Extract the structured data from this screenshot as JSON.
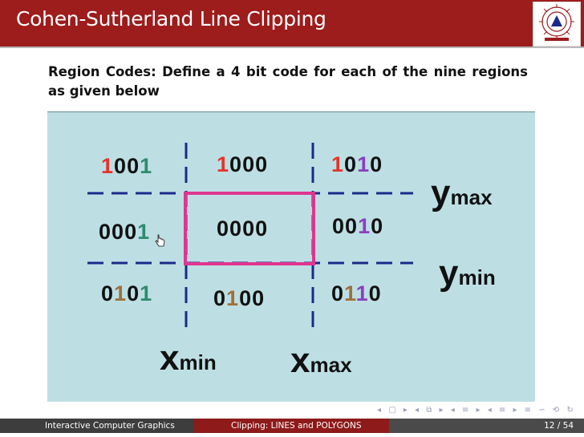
{
  "slide": {
    "title": "Cohen-Sutherland Line Clipping",
    "body": "Region Codes: Define a 4 bit code for each of the nine regions as given below"
  },
  "figure": {
    "codes": [
      {
        "name": "top-left",
        "digits": [
          "1",
          "0",
          "0",
          "1"
        ],
        "colors": [
          "#e8332a",
          "#111111",
          "#111111",
          "#2e8b6e"
        ]
      },
      {
        "name": "top",
        "digits": [
          "1",
          "0",
          "0",
          "0"
        ],
        "colors": [
          "#e8332a",
          "#111111",
          "#111111",
          "#111111"
        ]
      },
      {
        "name": "top-right",
        "digits": [
          "1",
          "0",
          "1",
          "0"
        ],
        "colors": [
          "#e8332a",
          "#111111",
          "#8a3fbf",
          "#111111"
        ]
      },
      {
        "name": "left",
        "digits": [
          "0",
          "0",
          "0",
          "1"
        ],
        "colors": [
          "#111111",
          "#111111",
          "#111111",
          "#2e8b6e"
        ]
      },
      {
        "name": "center",
        "digits": [
          "0",
          "0",
          "0",
          "0"
        ],
        "colors": [
          "#111111",
          "#111111",
          "#111111",
          "#111111"
        ]
      },
      {
        "name": "right",
        "digits": [
          "0",
          "0",
          "1",
          "0"
        ],
        "colors": [
          "#111111",
          "#111111",
          "#8a3fbf",
          "#111111"
        ]
      },
      {
        "name": "bottom-left",
        "digits": [
          "0",
          "1",
          "0",
          "1"
        ],
        "colors": [
          "#111111",
          "#a0703a",
          "#111111",
          "#2e8b6e"
        ]
      },
      {
        "name": "bottom",
        "digits": [
          "0",
          "1",
          "0",
          "0"
        ],
        "colors": [
          "#111111",
          "#a0703a",
          "#111111",
          "#111111"
        ]
      },
      {
        "name": "bottom-right",
        "digits": [
          "0",
          "1",
          "1",
          "0"
        ],
        "colors": [
          "#111111",
          "#a0703a",
          "#8a3fbf",
          "#111111"
        ]
      }
    ],
    "labels": {
      "ymax": {
        "base": "y",
        "sub": "max"
      },
      "ymin": {
        "base": "y",
        "sub": "min"
      },
      "xmin": {
        "base": "x",
        "sub": "min"
      },
      "xmax": {
        "base": "x",
        "sub": "max"
      }
    },
    "colors": {
      "background": "#bddfe4",
      "window": "#e0358f",
      "lines": "#1a2a8a"
    }
  },
  "footer": {
    "course": "Interactive Computer Graphics",
    "section": "Clipping: LINES and POLYGONS",
    "page": "12 / 54"
  }
}
